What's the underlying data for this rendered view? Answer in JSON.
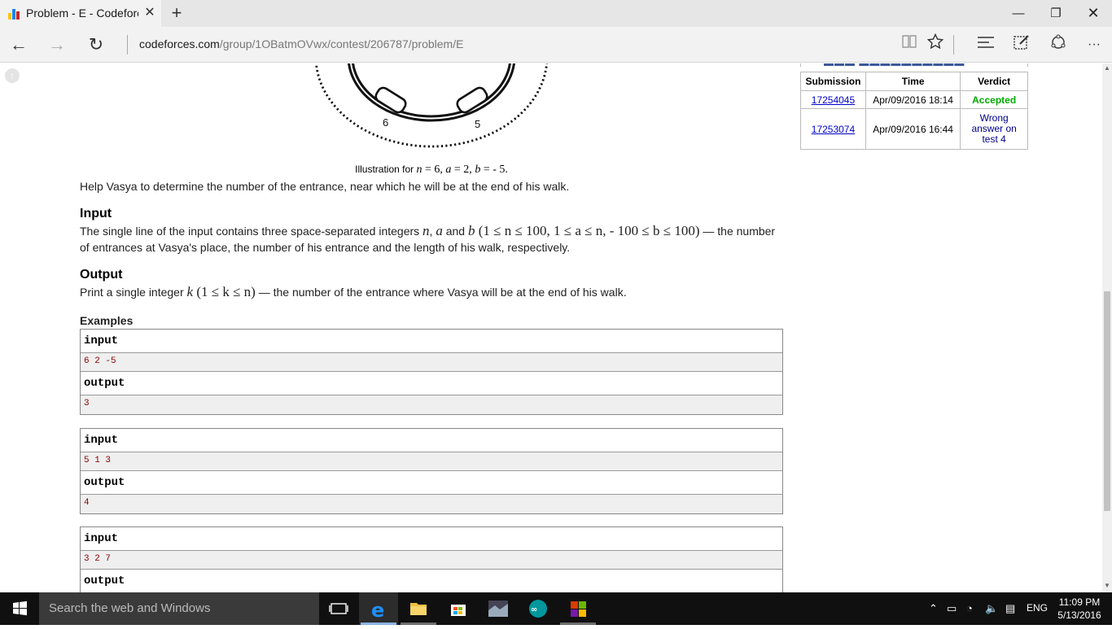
{
  "browser": {
    "tab_title": "Problem - E - Codeforce",
    "tab_close": "✕",
    "new_tab": "+",
    "minimize": "—",
    "restore": "❐",
    "close": "✕",
    "back": "←",
    "forward": "→",
    "refresh": "↻",
    "address_host": "codeforces.com",
    "address_path": "/group/1OBatmOVwx/contest/206787/problem/E",
    "more": "···"
  },
  "illustration": {
    "label_left": "6",
    "label_right": "5"
  },
  "caption": {
    "prefix": "Illustration for ",
    "n": "n",
    "eq1": " = 6, ",
    "a": "a",
    "eq2": " = 2, ",
    "b": "b",
    "eq3": " =  - 5."
  },
  "statement": {
    "help_text": "Help Vasya to determine the number of the entrance, near which he will be at the end of his walk.",
    "input_title": "Input",
    "input_text_1": "The single line of the input contains three space-separated integers ",
    "input_n": "n",
    "input_comma": ", ",
    "input_a": "a",
    "input_and": " and ",
    "input_b": "b",
    "input_constraints": " (1 ≤ n ≤ 100, 1 ≤ a ≤ n,  - 100 ≤ b ≤ 100)",
    "input_text_2": " — the number of entrances at Vasya's place, the number of his entrance and the length of his walk, respectively.",
    "output_title": "Output",
    "output_text_1": "Print a single integer ",
    "output_k": "k",
    "output_constraints": " (1 ≤ k ≤ n)",
    "output_text_2": " — the number of the entrance where Vasya will be at the end of his walk."
  },
  "examples": {
    "title": "Examples",
    "items": [
      {
        "input_label": "input",
        "input": "6 2 -5",
        "output_label": "output",
        "output": "3"
      },
      {
        "input_label": "input",
        "input": "5 1 3",
        "output_label": "output",
        "output": "4"
      },
      {
        "input_label": "input",
        "input": "3 2 7",
        "output_label": "output"
      }
    ]
  },
  "submissions": {
    "headers": [
      "Submission",
      "Time",
      "Verdict"
    ],
    "rows": [
      {
        "id": "17254045",
        "time": "Apr/09/2016 18:14",
        "verdict": "Accepted"
      },
      {
        "id": "17253074",
        "time": "Apr/09/2016 16:44",
        "verdict": "Wrong answer on test 4"
      }
    ]
  },
  "taskbar": {
    "search_placeholder": "Search the web and Windows",
    "language": "ENG",
    "time": "11:09 PM",
    "date": "5/13/2016"
  }
}
